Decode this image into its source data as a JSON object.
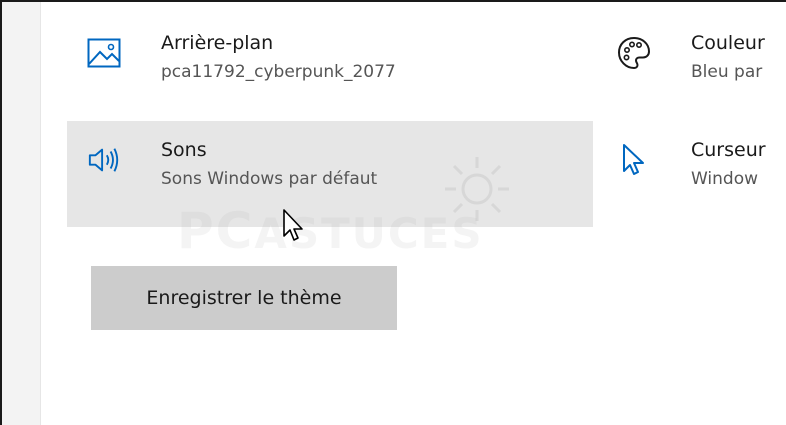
{
  "personalization": {
    "items": [
      {
        "title": "Arrière-plan",
        "subtitle": "pca11792_cyberpunk_2077",
        "icon": "picture-icon"
      },
      {
        "title": "Sons",
        "subtitle": "Sons Windows par défaut",
        "icon": "speaker-icon",
        "highlighted": true
      },
      {
        "title": "Couleur",
        "subtitle": "Bleu par",
        "icon": "palette-icon"
      },
      {
        "title": "Curseur",
        "subtitle": "Window",
        "icon": "pointer-icon"
      }
    ],
    "save_button": "Enregistrer le thème"
  },
  "watermark": {
    "brand": "PC",
    "brand_suffix": "ASTUCES"
  },
  "colors": {
    "accent": "#0067c0",
    "highlight": "#e6e6e6",
    "button": "#cccccc"
  }
}
